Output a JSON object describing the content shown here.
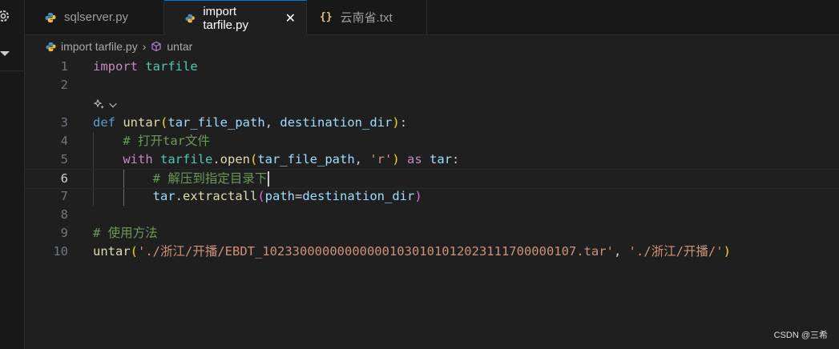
{
  "tabs": [
    {
      "label": "sqlserver.py",
      "icon": "python-icon",
      "active": false
    },
    {
      "label": "import tarfile.py",
      "icon": "python-icon",
      "active": true
    },
    {
      "label": "云南省.txt",
      "icon": "json-braces-icon",
      "active": false
    }
  ],
  "tab_json_glyph": "{}",
  "tab_close_glyph": "✕",
  "breadcrumb": {
    "file": "import tarfile.py",
    "separator": "›",
    "symbol": "untar"
  },
  "code_lines": [
    {
      "n": "1",
      "tokens": [
        [
          "kw",
          "import"
        ],
        [
          "pn",
          " "
        ],
        [
          "mod",
          "tarfile"
        ]
      ]
    },
    {
      "n": "2",
      "tokens": []
    },
    {
      "n": "3",
      "tokens": [
        [
          "def",
          "def"
        ],
        [
          "pn",
          " "
        ],
        [
          "fn",
          "untar"
        ],
        [
          "br1",
          "("
        ],
        [
          "param",
          "tar_file_path"
        ],
        [
          "pn",
          ", "
        ],
        [
          "param",
          "destination_dir"
        ],
        [
          "br1",
          ")"
        ],
        [
          "pn",
          ":"
        ]
      ]
    },
    {
      "n": "4",
      "tokens": [
        [
          "pn",
          "    "
        ],
        [
          "cm",
          "# 打开tar文件"
        ]
      ]
    },
    {
      "n": "5",
      "tokens": [
        [
          "pn",
          "    "
        ],
        [
          "kw",
          "with"
        ],
        [
          "pn",
          " "
        ],
        [
          "mod",
          "tarfile"
        ],
        [
          "pn",
          "."
        ],
        [
          "fn",
          "open"
        ],
        [
          "br1",
          "("
        ],
        [
          "param",
          "tar_file_path"
        ],
        [
          "pn",
          ", "
        ],
        [
          "str",
          "'r'"
        ],
        [
          "br1",
          ")"
        ],
        [
          "pn",
          " "
        ],
        [
          "kw",
          "as"
        ],
        [
          "pn",
          " "
        ],
        [
          "param",
          "tar"
        ],
        [
          "pn",
          ":"
        ]
      ]
    },
    {
      "n": "6",
      "tokens": [
        [
          "pn",
          "        "
        ],
        [
          "cm",
          "# 解压到指定目录下"
        ]
      ]
    },
    {
      "n": "7",
      "tokens": [
        [
          "pn",
          "        "
        ],
        [
          "param",
          "tar"
        ],
        [
          "pn",
          "."
        ],
        [
          "fn",
          "extractall"
        ],
        [
          "br2",
          "("
        ],
        [
          "param",
          "path"
        ],
        [
          "pn",
          "="
        ],
        [
          "param",
          "destination_dir"
        ],
        [
          "br2",
          ")"
        ]
      ]
    },
    {
      "n": "8",
      "tokens": []
    },
    {
      "n": "9",
      "tokens": [
        [
          "cm",
          "# 使用方法"
        ]
      ]
    },
    {
      "n": "10",
      "tokens": [
        [
          "fn",
          "untar"
        ],
        [
          "br1",
          "("
        ],
        [
          "str",
          "'./浙江/开播/EBDT_10233000000000000103010101202311170000010​7.tar'"
        ],
        [
          "pn",
          ", "
        ],
        [
          "str",
          "'./浙江/开播/'"
        ],
        [
          "br1",
          ")"
        ]
      ]
    }
  ],
  "current_line": "6",
  "watermark": "CSDN @三希",
  "colors": {
    "accent": "#0078d4",
    "editor_bg": "#1f1f1f"
  }
}
